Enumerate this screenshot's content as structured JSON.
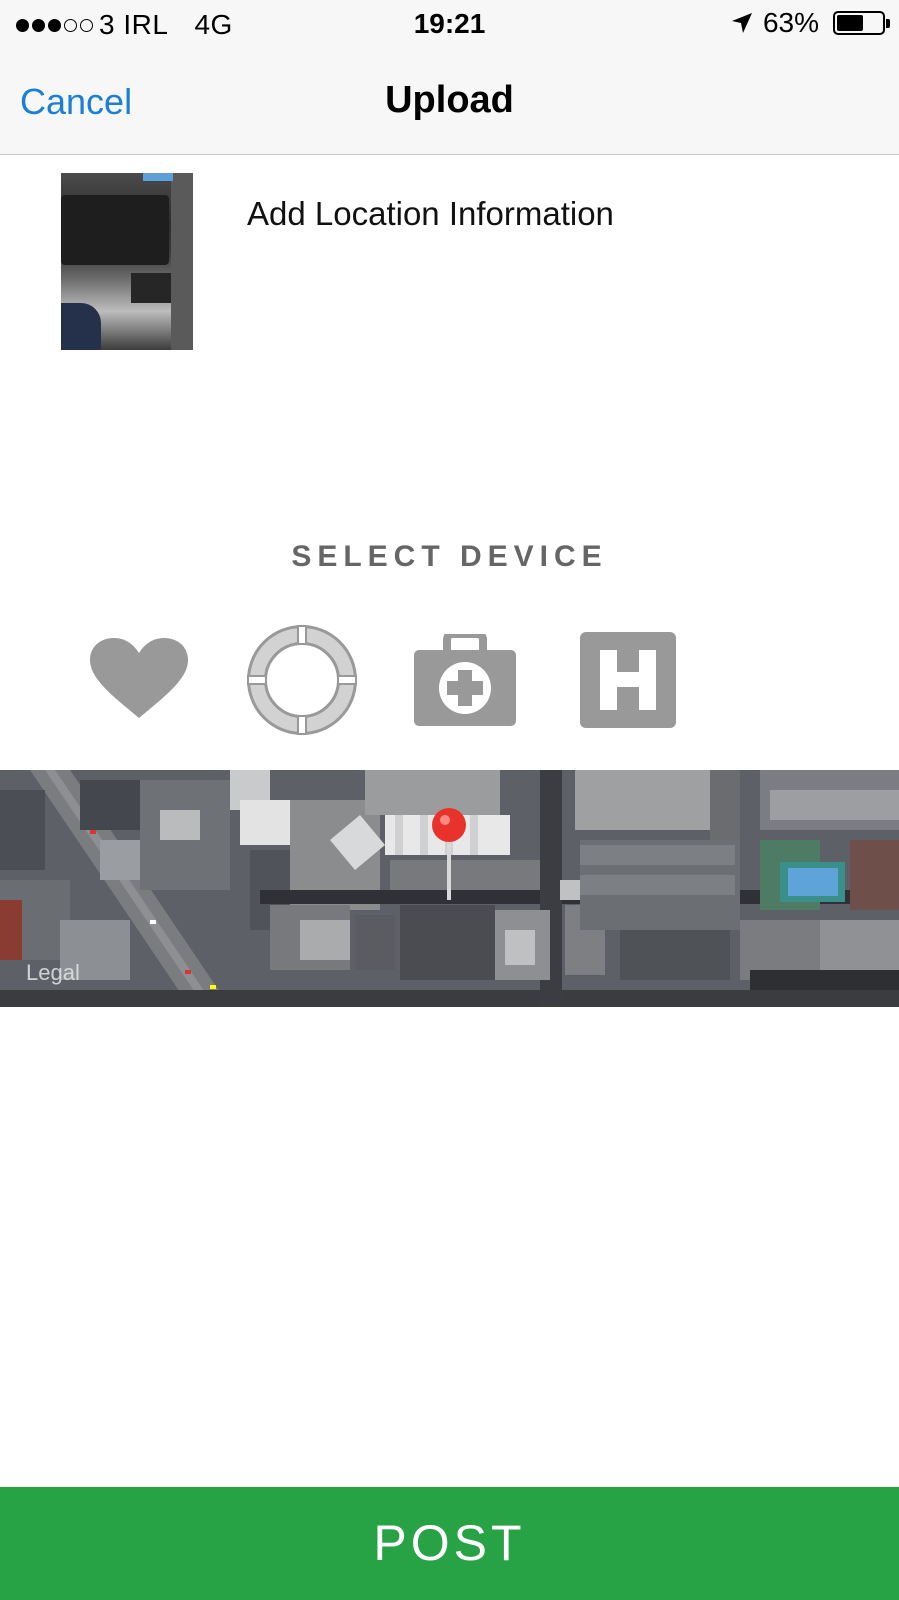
{
  "status_bar": {
    "signal": {
      "filled": 3,
      "total": 5
    },
    "carrier": "3 IRL",
    "network": "4G",
    "time": "19:21",
    "location_icon": "location-arrow-icon",
    "battery_text": "63%",
    "battery_level": 0.63
  },
  "nav": {
    "cancel_label": "Cancel",
    "title": "Upload"
  },
  "upload": {
    "thumbnail_icon": "photo-thumbnail",
    "location_prompt": "Add Location Information"
  },
  "device_section": {
    "heading": "SELECT DEVICE",
    "icon_color": "#999999",
    "devices": [
      {
        "icon": "heart-icon"
      },
      {
        "icon": "lifebuoy-icon"
      },
      {
        "icon": "first-aid-kit-icon"
      },
      {
        "icon": "hospital-h-icon"
      }
    ]
  },
  "map": {
    "legal_label": "Legal",
    "pin_icon": "map-pin-icon",
    "pin_color": "#e8322c"
  },
  "post_button": {
    "label": "POST",
    "color": "#27a245"
  },
  "colors": {
    "link_blue": "#1a7fd6",
    "bar_background": "#f7f7f7"
  }
}
